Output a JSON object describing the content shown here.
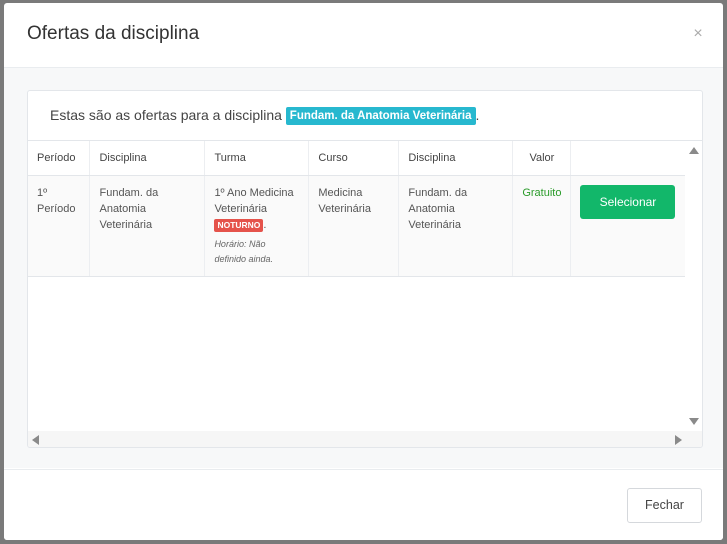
{
  "modal": {
    "title": "Ofertas da disciplina",
    "close_symbol": "×"
  },
  "intro": {
    "text": "Estas são as ofertas para a disciplina",
    "discipline_badge": "Fundam. da Anatomia Veterinária",
    "suffix": "."
  },
  "table": {
    "headers": [
      "Período",
      "Disciplina",
      "Turma",
      "Curso",
      "Disciplina",
      "Valor",
      ""
    ],
    "rows": [
      {
        "periodo": "1º Período",
        "disciplina": "Fundam. da Anatomia Veterinária",
        "turma": "1º Ano Medicina Veterinária",
        "turno_badge": "NOTURNO",
        "turno_suffix": ".",
        "horario": "Horário: Não definido ainda.",
        "curso": "Medicina Veterinária",
        "disciplina2": "Fundam. da Anatomia Veterinária",
        "valor": "Gratuito",
        "action_label": "Selecionar"
      }
    ]
  },
  "footer": {
    "close_label": "Fechar"
  },
  "colors": {
    "badge_discipline": "#27b8cf",
    "badge_noturno": "#e5534b",
    "select_button": "#12b76a",
    "valor_text": "#2a9b2a"
  }
}
